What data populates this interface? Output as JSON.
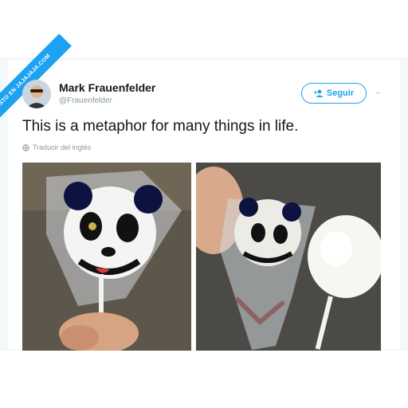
{
  "ribbon": {
    "label": "VISTO EN JAJAJAJA.COM"
  },
  "user": {
    "name": "Mark Frauenfelder",
    "handle": "@Frauenfelder"
  },
  "follow": {
    "label": "Seguir",
    "icon": "add-user-icon"
  },
  "tweet": {
    "text": "This is a metaphor for many things in life."
  },
  "translate": {
    "label": "Traducir del inglés",
    "icon": "globe-icon"
  },
  "colors": {
    "accent": "#1da1f2",
    "text": "#14171a",
    "muted": "#8899a6"
  },
  "photos": [
    {
      "description_icon": "panda-lollipop-wrapped"
    },
    {
      "description_icon": "panda-lollipop-unwrapped"
    }
  ]
}
